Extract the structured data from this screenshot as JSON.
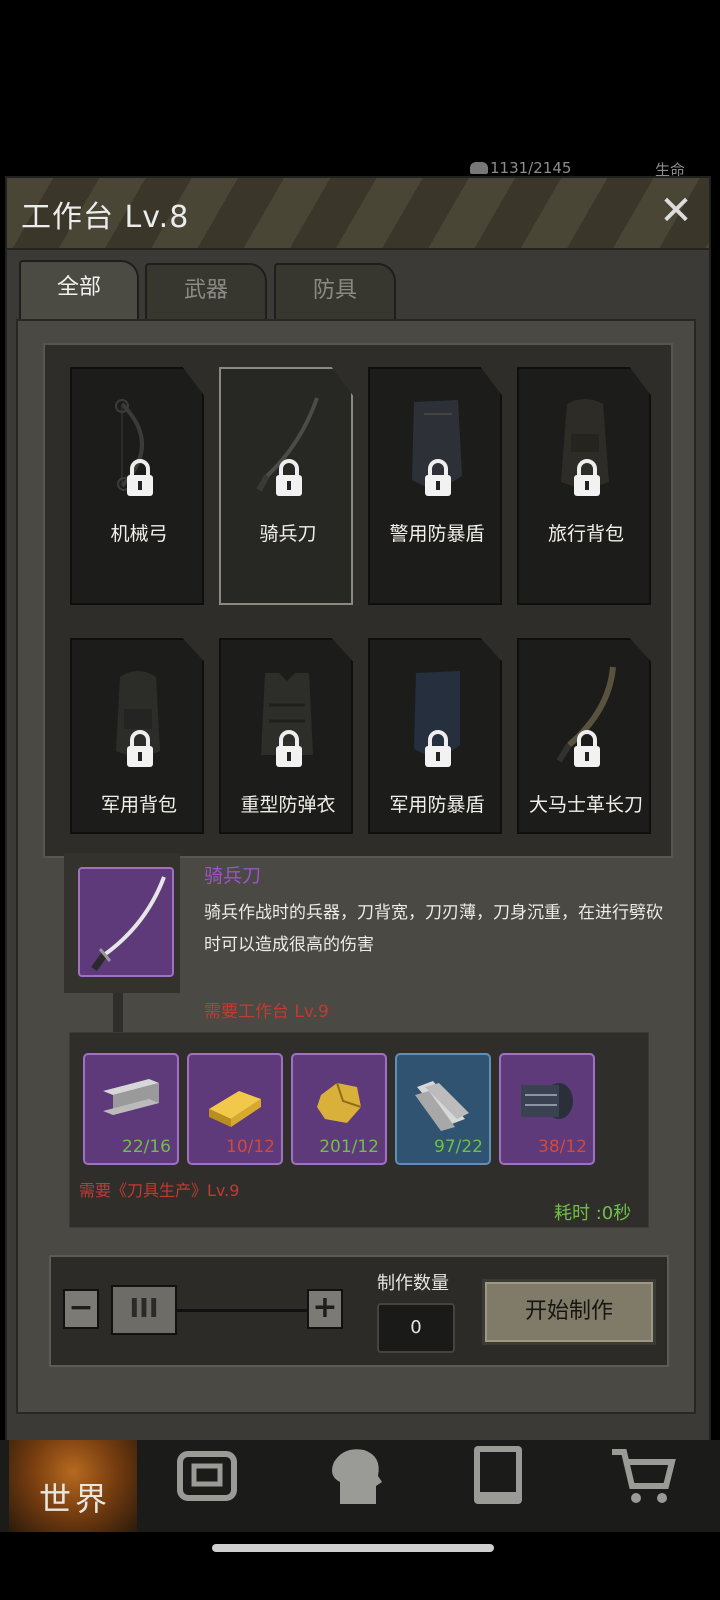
{
  "status": {
    "resource": "1131/2145",
    "life": "生命"
  },
  "window": {
    "title": "工作台 Lv.8",
    "close": "✕"
  },
  "tabs": [
    {
      "label": "全部",
      "active": true
    },
    {
      "label": "武器",
      "active": false
    },
    {
      "label": "防具",
      "active": false
    }
  ],
  "items": [
    {
      "name": "机械弓",
      "icon": "compound-bow-icon",
      "locked": true
    },
    {
      "name": "骑兵刀",
      "icon": "saber-icon",
      "locked": true,
      "selected": true
    },
    {
      "name": "警用防暴盾",
      "icon": "police-riot-shield-icon",
      "locked": true
    },
    {
      "name": "旅行背包",
      "icon": "travel-backpack-icon",
      "locked": true
    },
    {
      "name": "军用背包",
      "icon": "military-backpack-icon",
      "locked": true
    },
    {
      "name": "重型防弹衣",
      "icon": "heavy-body-armor-icon",
      "locked": true
    },
    {
      "name": "军用防暴盾",
      "icon": "military-riot-shield-icon",
      "locked": true
    },
    {
      "name": "大马士革长刀",
      "icon": "damascus-blade-icon",
      "locked": true
    }
  ],
  "detail": {
    "name": "骑兵刀",
    "description": "骑兵作战时的兵器，刀背宽，刀刃薄，刀身沉重，在进行劈砍时可以造成很高的伤害",
    "requirement": "需要工作台 Lv.9",
    "skill_requirement": "需要《刀具生产》Lv.9",
    "time_cost": "耗时 :0秒"
  },
  "materials": [
    {
      "qty": "22/16",
      "ok": true,
      "icon": "steel-beam-icon",
      "color": "purple"
    },
    {
      "qty": "10/12",
      "ok": false,
      "icon": "gold-bar-icon",
      "color": "purple"
    },
    {
      "qty": "201/12",
      "ok": true,
      "icon": "gold-ore-icon",
      "color": "purple"
    },
    {
      "qty": "97/22",
      "ok": true,
      "icon": "metal-plates-icon",
      "color": "blue"
    },
    {
      "qty": "38/12",
      "ok": false,
      "icon": "rubber-roll-icon",
      "color": "purple"
    }
  ],
  "control": {
    "minus": "−",
    "plus": "+",
    "thumb": "III",
    "qty_label": "制作数量",
    "qty_value": "0",
    "start": "开始制作"
  },
  "nav": {
    "world": "世界",
    "icons": [
      "backpack-icon",
      "head-gear-icon",
      "phone-icon",
      "cart-icon"
    ]
  },
  "colors": {
    "accent_purple": "#a070c4",
    "warning_red": "#c23a32",
    "ok_green": "#6fbf4a"
  }
}
